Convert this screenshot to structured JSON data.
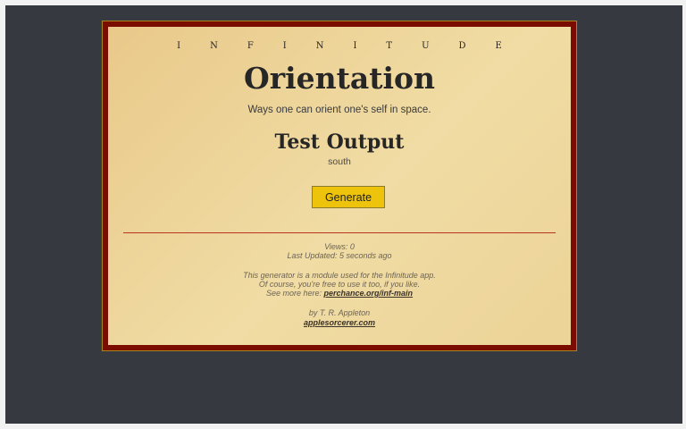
{
  "app": {
    "brand": "INFINITUDE",
    "title": "Orientation",
    "subtitle": "Ways one can orient one's self in space."
  },
  "output": {
    "heading": "Test Output",
    "value": "south"
  },
  "actions": {
    "generate_label": "Generate"
  },
  "meta": {
    "views": "Views: 0",
    "last_updated": "Last Updated: 5 seconds ago",
    "about_line1": "This generator is a module used for the Infinitude app.",
    "about_line2": "Of course, you're free to use it too, if you like.",
    "about_line3_prefix": "See more here: ",
    "about_link": "perchance.org/inf-main",
    "byline": "by T. R. Appleton",
    "site_link": "applesorcerer.com"
  },
  "colors": {
    "page_bg": "#363a40",
    "frame": "#7a0d00",
    "card": "#f0dca4",
    "button": "#eec30c",
    "divider": "#b8361e"
  }
}
